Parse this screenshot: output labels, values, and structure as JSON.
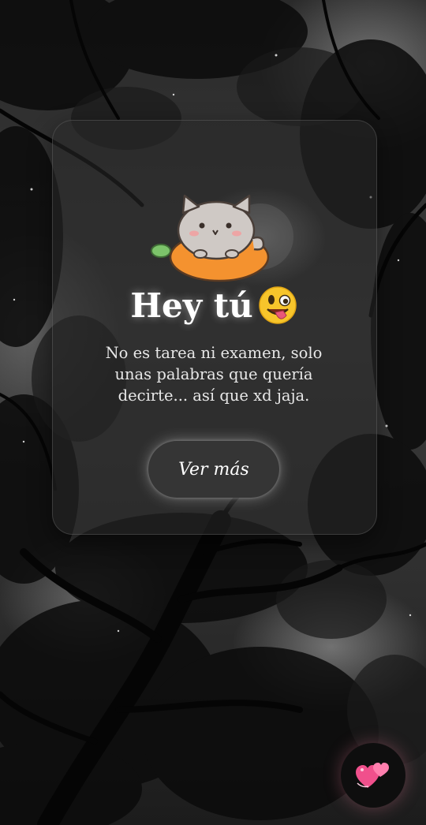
{
  "greeting": {
    "title": "Hey tú",
    "emoji_icon": "winking-tongue-face-icon",
    "sticker_icon": "cat-on-carrot-sticker"
  },
  "message": {
    "text": "No es tarea ni examen, solo unas palabras que quería decirte... así que xd jaja."
  },
  "actions": {
    "primary_label": "Ver más",
    "fab_icon": "two-hearts-icon"
  },
  "colors": {
    "card_bg": "#282828",
    "button_bg": "#353535",
    "text": "#ffffff",
    "heart_pink": "#f0508c"
  }
}
